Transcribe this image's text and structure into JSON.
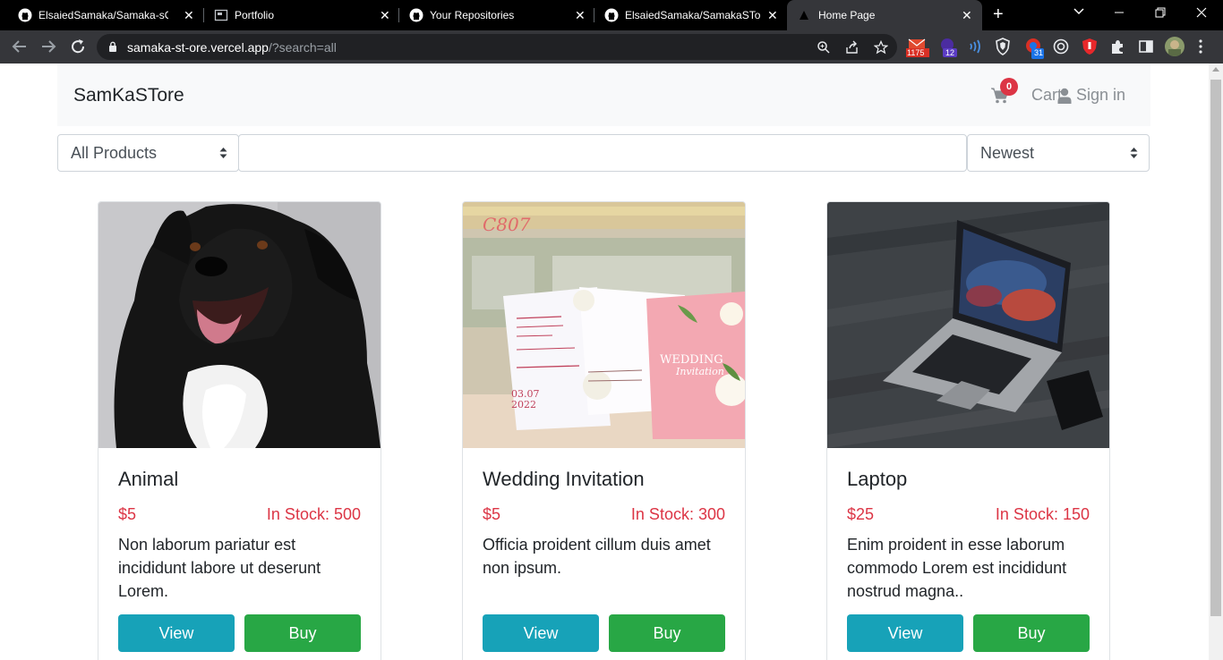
{
  "browser": {
    "tabs": [
      {
        "title": "ElsaiedSamaka/Samaka-sOFFi",
        "icon": "github-icon",
        "active": false
      },
      {
        "title": "Portfolio",
        "icon": "page-icon",
        "active": false
      },
      {
        "title": "Your Repositories",
        "icon": "github-icon",
        "active": false
      },
      {
        "title": "ElsaiedSamaka/SamakaSTore",
        "icon": "github-icon",
        "active": false
      },
      {
        "title": "Home Page",
        "icon": "vercel-icon",
        "active": true
      }
    ],
    "url_host": "samaka-st-ore.vercel.app",
    "url_path": "/?search=all",
    "extension_badges": {
      "mail": "1175",
      "purple": "12",
      "calendar": "31"
    }
  },
  "navbar": {
    "brand": "SamKaSTore",
    "cart_count": "0",
    "cart_label": "Cart",
    "signin_label": "Sign in"
  },
  "filters": {
    "category": "All Products",
    "search_value": "",
    "sort": "Newest"
  },
  "products": [
    {
      "title": "Animal",
      "price": "$5",
      "stock": "In Stock: 500",
      "description": "Non laborum pariatur est incididunt labore ut deserunt Lorem.",
      "view_label": "View",
      "buy_label": "Buy"
    },
    {
      "title": "Wedding Invitation",
      "price": "$5",
      "stock": "In Stock: 300",
      "description": "Officia proident cillum duis amet non ipsum.",
      "view_label": "View",
      "buy_label": "Buy",
      "image_text": {
        "code": "C807",
        "card_word": "WEDDING",
        "card_script": "Invitation",
        "date_a": "03.07",
        "date_b": "2022"
      }
    },
    {
      "title": "Laptop",
      "price": "$25",
      "stock": "In Stock: 150",
      "description": "Enim proident in esse laborum commodo Lorem est incididunt nostrud magna..",
      "view_label": "View",
      "buy_label": "Buy"
    }
  ],
  "colors": {
    "danger": "#dc3545",
    "info": "#17a2b8",
    "success": "#28a745",
    "navbar_bg": "#f8f9fa"
  }
}
